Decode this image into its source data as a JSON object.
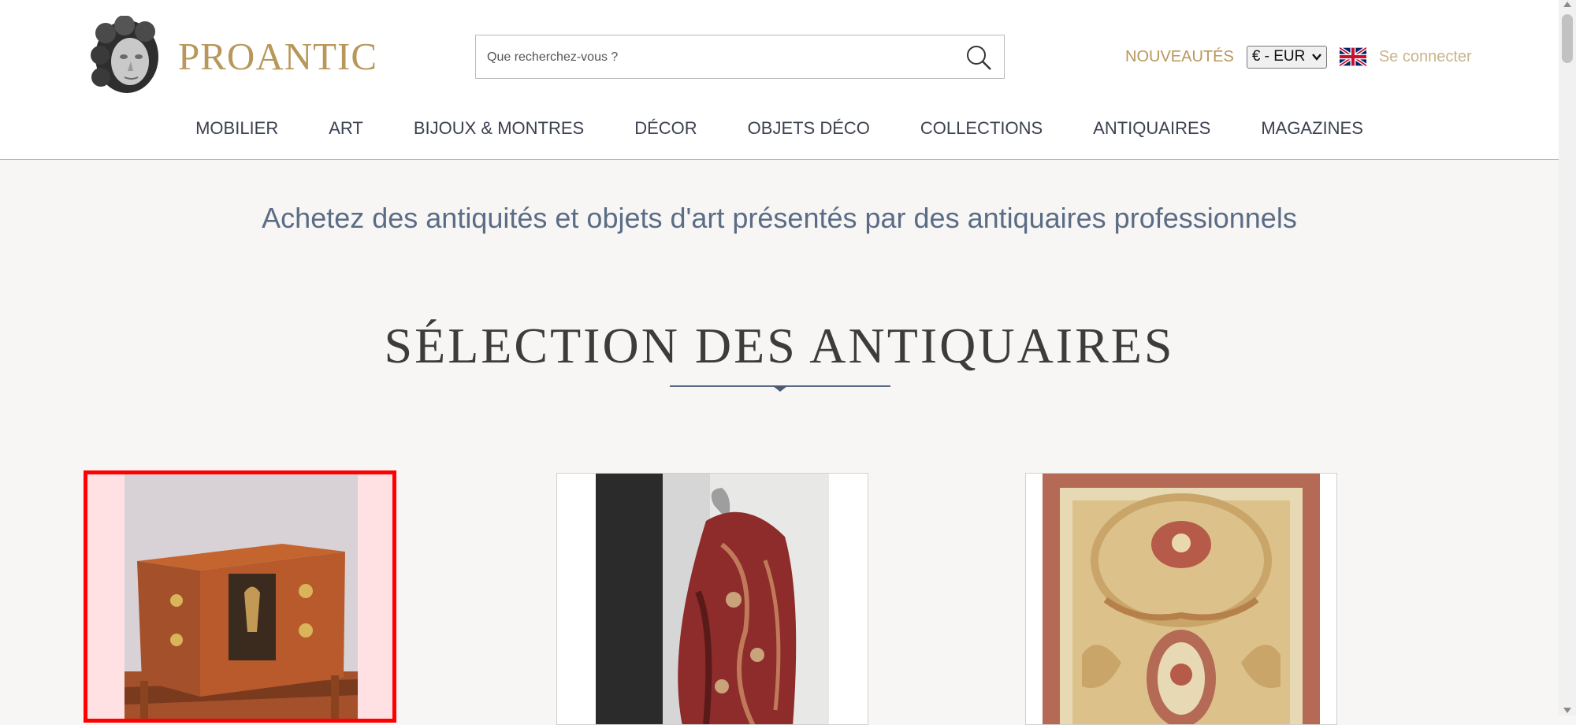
{
  "brand": {
    "name": "PROANTIC",
    "color": "#b8975a"
  },
  "search": {
    "placeholder": "Que recherchez-vous ?",
    "value": ""
  },
  "top_right": {
    "new_label": "NOUVEAUTÉS",
    "currency": "€ - EUR",
    "language_flag": "uk-flag-icon",
    "login_label": "Se connecter"
  },
  "nav": {
    "items": [
      "MOBILIER",
      "ART",
      "BIJOUX & MONTRES",
      "DÉCOR",
      "OBJETS DÉCO",
      "COLLECTIONS",
      "ANTIQUAIRES",
      "MAGAZINES"
    ]
  },
  "main": {
    "tagline": "Achetez des antiquités et objets d'art présentés par des antiquaires professionnels",
    "section_title": "SÉLECTION DES ANTIQUAIRES"
  },
  "products": [
    {
      "icon": "commode-image",
      "highlighted": true
    },
    {
      "icon": "textile-image",
      "highlighted": false
    },
    {
      "icon": "aubusson-rug-image",
      "highlighted": false
    }
  ]
}
